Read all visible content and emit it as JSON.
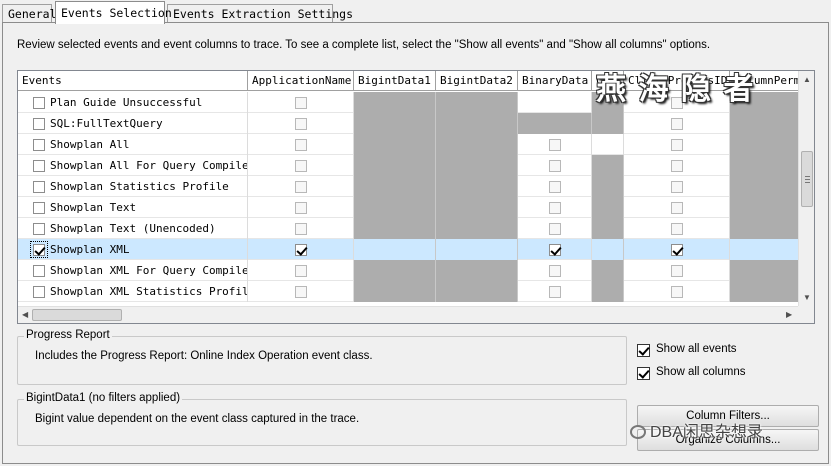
{
  "tabs": [
    {
      "label": "General",
      "active": false
    },
    {
      "label": "Events Selection",
      "active": true
    },
    {
      "label": "Events Extraction Settings",
      "active": false
    }
  ],
  "description": "Review selected events and event columns to trace. To see a complete list, select the \"Show all events\" and \"Show all columns\" options.",
  "grid": {
    "columns": [
      "Events",
      "ApplicationName",
      "BigintData1",
      "BigintData2",
      "BinaryData",
      "CPU",
      "ClientProcessID",
      "ColumnPermi"
    ],
    "rows": [
      {
        "event": "Plan Guide Unsuccessful",
        "checked": false,
        "cells": [
          "cb",
          "gray",
          "gray",
          "",
          "gray",
          "cb",
          "gray"
        ]
      },
      {
        "event": "SQL:FullTextQuery",
        "checked": false,
        "cells": [
          "cb",
          "gray",
          "gray",
          "gray",
          "gray",
          "cb",
          "gray"
        ]
      },
      {
        "event": "Showplan All",
        "checked": false,
        "cells": [
          "cb",
          "gray",
          "gray",
          "cb",
          "",
          "cb",
          "gray"
        ]
      },
      {
        "event": "Showplan All For Query Compile",
        "checked": false,
        "cells": [
          "cb",
          "gray",
          "gray",
          "cb",
          "gray",
          "cb",
          "gray"
        ]
      },
      {
        "event": "Showplan Statistics Profile",
        "checked": false,
        "cells": [
          "cb",
          "gray",
          "gray",
          "cb",
          "gray",
          "cb",
          "gray"
        ]
      },
      {
        "event": "Showplan Text",
        "checked": false,
        "cells": [
          "cb",
          "gray",
          "gray",
          "cb",
          "gray",
          "cb",
          "gray"
        ]
      },
      {
        "event": "Showplan Text (Unencoded)",
        "checked": false,
        "cells": [
          "cb",
          "gray",
          "gray",
          "cb",
          "gray",
          "cb",
          "gray"
        ]
      },
      {
        "event": "Showplan XML",
        "checked": true,
        "selected": true,
        "cells": [
          "cbon",
          "gray",
          "gray",
          "cbon",
          "gray",
          "cbon",
          "gray"
        ]
      },
      {
        "event": "Showplan XML For Query Compile",
        "checked": false,
        "cells": [
          "cb",
          "gray",
          "gray",
          "cb",
          "gray",
          "cb",
          "gray"
        ]
      },
      {
        "event": "Showplan XML Statistics Profile",
        "checked": false,
        "cells": [
          "cb",
          "gray",
          "gray",
          "cb",
          "gray",
          "cb",
          "gray"
        ]
      }
    ]
  },
  "progress_report": {
    "title": "Progress Report",
    "text": "Includes the Progress Report: Online Index Operation event class."
  },
  "bigint_group": {
    "title": "BigintData1 (no filters applied)",
    "text": "Bigint value dependent on the event class captured in the trace."
  },
  "options": {
    "show_all_events": "Show all events",
    "show_all_columns": "Show all columns",
    "show_all_events_checked": true,
    "show_all_columns_checked": true
  },
  "buttons": {
    "column_filters": "Column Filters...",
    "organize_columns": "Organize Columns..."
  },
  "watermark": {
    "overlay": "燕 海 隐 者",
    "footer": "DBA闲思杂想录"
  }
}
